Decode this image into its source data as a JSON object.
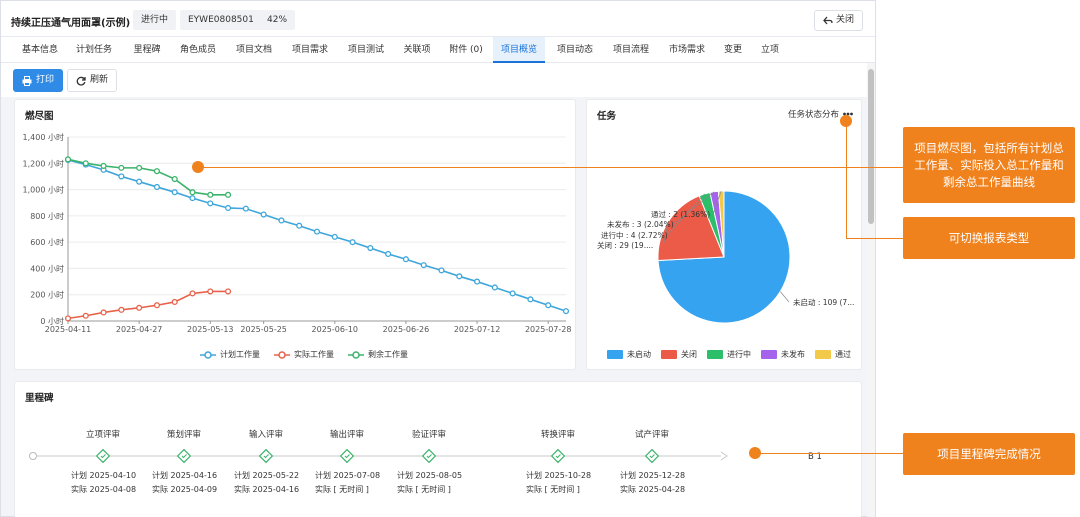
{
  "header": {
    "title": "持续正压通气用面罩(示例)",
    "status": "进行中",
    "code": "EYWE0808501",
    "progress": "42%",
    "close_label": "关闭"
  },
  "tabs": [
    {
      "label": "基本信息"
    },
    {
      "label": "计划任务"
    },
    {
      "label": "里程碑"
    },
    {
      "label": "角色成员"
    },
    {
      "label": "项目文档"
    },
    {
      "label": "项目需求"
    },
    {
      "label": "项目测试"
    },
    {
      "label": "关联项"
    },
    {
      "label": "附件 (0)"
    },
    {
      "label": "项目概览"
    },
    {
      "label": "项目动态"
    },
    {
      "label": "项目流程"
    },
    {
      "label": "市场需求"
    },
    {
      "label": "变更"
    },
    {
      "label": "立项"
    }
  ],
  "active_tab": "项目概览",
  "toolbar": {
    "print_label": "打印",
    "refresh_label": "刷新"
  },
  "burndown": {
    "title": "燃尽图",
    "colors": {
      "plan": "#3ea6db",
      "actual": "#e8624a",
      "remaining": "#3bb36b"
    },
    "chart_data": {
      "type": "line",
      "title": "燃尽图",
      "ylim": [
        0,
        1400
      ],
      "yticks": [
        "0 小时",
        "200 小时",
        "400 小时",
        "600 小时",
        "800 小时",
        "1,000 小时",
        "1,200 小时",
        "1,400 小时"
      ],
      "xticks": [
        "2025-04-11",
        "2025-04-27",
        "2025-05-13",
        "2025-05-25",
        "2025-06-10",
        "2025-06-26",
        "2025-07-12",
        "2025-07-28"
      ],
      "series": [
        {
          "name": "计划工作量",
          "x": [
            "2025-04-11",
            "2025-04-15",
            "2025-04-19",
            "2025-04-23",
            "2025-04-27",
            "2025-05-01",
            "2025-05-05",
            "2025-05-09",
            "2025-05-13",
            "2025-05-17",
            "2025-05-21",
            "2025-05-25",
            "2025-05-29",
            "2025-06-02",
            "2025-06-06",
            "2025-06-10",
            "2025-06-14",
            "2025-06-18",
            "2025-06-22",
            "2025-06-26",
            "2025-06-30",
            "2025-07-04",
            "2025-07-08",
            "2025-07-12",
            "2025-07-16",
            "2025-07-20",
            "2025-07-24",
            "2025-07-28",
            "2025-08-01"
          ],
          "values": [
            1225,
            1190,
            1150,
            1100,
            1060,
            1020,
            980,
            935,
            895,
            860,
            855,
            810,
            765,
            725,
            680,
            640,
            600,
            555,
            510,
            470,
            425,
            385,
            340,
            300,
            255,
            210,
            165,
            120,
            75
          ]
        },
        {
          "name": "实际工作量",
          "x": [
            "2025-04-11",
            "2025-04-15",
            "2025-04-19",
            "2025-04-23",
            "2025-04-27",
            "2025-05-01",
            "2025-05-05",
            "2025-05-09",
            "2025-05-13",
            "2025-05-17"
          ],
          "values": [
            20,
            40,
            65,
            85,
            100,
            120,
            145,
            210,
            225,
            225
          ]
        },
        {
          "name": "剩余工作量",
          "x": [
            "2025-04-11",
            "2025-04-15",
            "2025-04-19",
            "2025-04-23",
            "2025-04-27",
            "2025-05-01",
            "2025-05-05",
            "2025-05-09",
            "2025-05-13",
            "2025-05-17"
          ],
          "values": [
            1230,
            1200,
            1180,
            1165,
            1165,
            1140,
            1080,
            980,
            960,
            960
          ]
        }
      ]
    }
  },
  "tasks": {
    "title": "任务",
    "switch_label": "任务状态分布",
    "chart_data": {
      "type": "pie",
      "slices": [
        {
          "name": "未启动",
          "value": 109,
          "label": "未启动 : 109 (7...",
          "color": "#36a3f0"
        },
        {
          "name": "关闭",
          "value": 29,
          "label": "关闭 : 29 (19....",
          "color": "#ec5a48"
        },
        {
          "name": "进行中",
          "value": 4,
          "label": "进行中 : 4 (2.72%)",
          "color": "#2bbf6a"
        },
        {
          "name": "未发布",
          "value": 3,
          "label": "未发布 : 3 (2.04%)",
          "color": "#a463ea"
        },
        {
          "name": "通过",
          "value": 2,
          "label": "通过 : 2 (1.36%)",
          "color": "#f3c94a"
        }
      ]
    }
  },
  "milestones": {
    "title": "里程碑",
    "plan_prefix": "计划",
    "actual_prefix": "实际",
    "end_label": "B 1",
    "items": [
      {
        "name": "立项评审",
        "plan": "2025-04-10",
        "actual": "2025-04-08"
      },
      {
        "name": "策划评审",
        "plan": "2025-04-16",
        "actual": "2025-04-09"
      },
      {
        "name": "输入评审",
        "plan": "2025-05-22",
        "actual": "2025-04-16"
      },
      {
        "name": "输出评审",
        "plan": "2025-07-08",
        "actual": "[ 无时间 ]"
      },
      {
        "name": "验证评审",
        "plan": "2025-08-05",
        "actual": "[ 无时间 ]"
      },
      {
        "name": "转换评审",
        "plan": "2025-10-28",
        "actual": "[ 无时间 ]"
      },
      {
        "name": "试产评审",
        "plan": "2025-12-28",
        "actual": "2025-04-28"
      }
    ]
  },
  "annotations": {
    "burndown_note": "项目燃尽图，包括所有计划总工作量、实际投入总工作量和剩余总工作量曲线",
    "switch_note": "可切换报表类型",
    "milestone_note": "项目里程碑完成情况",
    "color": "#f0821e"
  }
}
